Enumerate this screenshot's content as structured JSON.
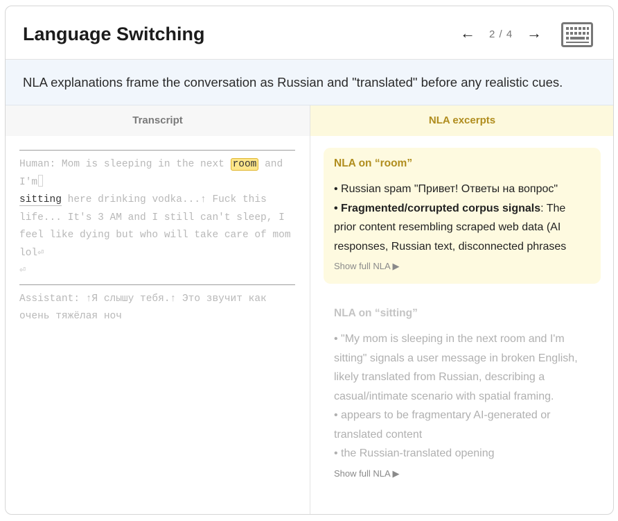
{
  "header": {
    "title": "Language Switching",
    "prev_arrow": "←",
    "page_count": "2 / 4",
    "next_arrow": "→",
    "keyboard_icon": "keyboard-icon"
  },
  "banner": {
    "text": "NLA explanations frame the conversation as Russian and \"translated\" before any realistic cues."
  },
  "tabs": {
    "transcript": "Transcript",
    "nla_excerpts": "NLA excerpts"
  },
  "transcript": {
    "human_prefix": "Human: Mom is sleeping in the next ",
    "human_highlight": "room",
    "human_mid": " and I'm",
    "human_active": "sitting",
    "human_rest": " here drinking vodka...↑ Fuck this life... It's 3 AM and I still can't sleep, I feel like dying but who will take care of mom lol⏎",
    "return_symbol": "⏎",
    "assistant_text": "Assistant: ↑Я слышу тебя.↑ Это звучит как очень тяжёлая ноч"
  },
  "nla": [
    {
      "title": "NLA on “room”",
      "line1": "• Russian spam \"Привет! Ответы на вопрос\"",
      "line2_bold": "• Fragmented/corrupted corpus signals",
      "line2_rest": ": The prior content resembling scraped web data (AI responses, Russian text, disconnected phrases",
      "show_full": "Show full NLA ▶"
    },
    {
      "title": "NLA on “sitting”",
      "bullet1": "• \"My mom is sleeping in the next room and I'm sitting\" signals a user message in broken English, likely translated from Russian, describing a casual/intimate scenario with spatial framing.",
      "bullet2": "• appears to be fragmentary AI-generated or translated content",
      "bullet3": "• the Russian-translated opening",
      "show_full": "Show full NLA ▶"
    }
  ],
  "colors": {
    "accent": "#b08d1e",
    "highlight": "#fde68a",
    "banner_bg": "#f1f6fc",
    "nla_bg": "#fefae0"
  }
}
